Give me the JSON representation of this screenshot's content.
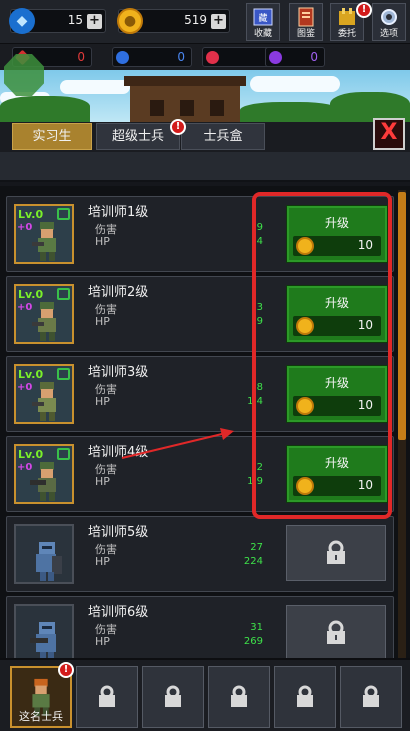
{
  "topbar": {
    "diamonds": "15",
    "coins": "519",
    "buttons": [
      {
        "label": "收藏",
        "icon": "book-collection-icon"
      },
      {
        "label": "图鉴",
        "icon": "codex-icon"
      },
      {
        "label": "委托",
        "icon": "commission-icon"
      },
      {
        "label": "选项",
        "icon": "gear-icon"
      }
    ],
    "alert_mark": "!"
  },
  "gems": [
    {
      "color": "#d23030",
      "value": "0",
      "icon": "red-crystal-icon"
    },
    {
      "color": "#2f6fe0",
      "value": "0",
      "icon": "blue-gem-icon"
    },
    {
      "color": "#e0304a",
      "value": "0",
      "icon": "red-gem-icon"
    },
    {
      "color": "#8a3ae0",
      "value": "0",
      "icon": "purple-gem-icon"
    }
  ],
  "tabs": [
    {
      "label": "实习生",
      "active": true
    },
    {
      "label": "超级士兵",
      "active": false
    },
    {
      "label": "士兵盒",
      "active": false
    }
  ],
  "close_label": "X",
  "list": {
    "level_tag": "Lv.0",
    "plus_tag": "+0",
    "damage_label": "伤害",
    "hp_label": "HP",
    "upgrade_label": "升级",
    "rows": [
      {
        "name": "培训师1级",
        "damage": "9",
        "hp": "4",
        "cost": "10",
        "locked": false
      },
      {
        "name": "培训师2级",
        "damage": "3",
        "hp": "9",
        "cost": "10",
        "locked": false
      },
      {
        "name": "培训师3级",
        "damage": "8",
        "hp": "1 4",
        "cost": "10",
        "locked": false
      },
      {
        "name": "培训师4级",
        "damage": "2",
        "hp": "1 9",
        "cost": "10",
        "locked": false
      },
      {
        "name": "培训师5级",
        "damage": "27",
        "hp": "224",
        "locked": true
      },
      {
        "name": "培训师6级",
        "damage": "31",
        "hp": "269",
        "locked": true
      }
    ]
  },
  "bottombar": {
    "selected_label": "这名士兵",
    "alert_mark": "!"
  },
  "colors": {
    "accent_green": "#1f7b1c",
    "highlight_red": "#e02828",
    "tab_active": "#a9822e"
  }
}
